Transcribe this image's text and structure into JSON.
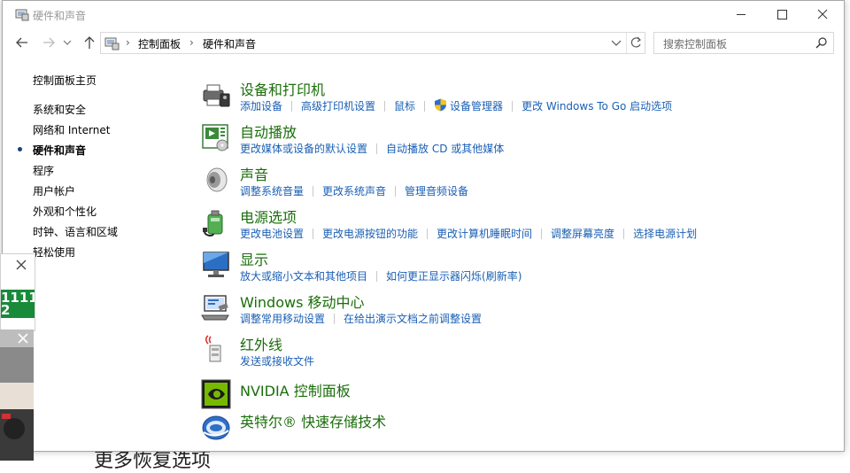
{
  "background": {
    "partial_text": "更多恢复选项"
  },
  "window": {
    "title": "硬件和声音"
  },
  "address": {
    "crumbs": [
      "控制面板",
      "硬件和声音"
    ],
    "search_placeholder": "搜索控制面板"
  },
  "sidebar": {
    "items": [
      {
        "label": "控制面板主页",
        "selected": false
      },
      {
        "label": "系统和安全",
        "selected": false
      },
      {
        "label": "网络和 Internet",
        "selected": false
      },
      {
        "label": "硬件和声音",
        "selected": true
      },
      {
        "label": "程序",
        "selected": false
      },
      {
        "label": "用户帐户",
        "selected": false
      },
      {
        "label": "外观和个性化",
        "selected": false
      },
      {
        "label": "时钟、语言和区域",
        "selected": false
      },
      {
        "label": "轻松使用",
        "selected": false
      }
    ]
  },
  "categories": [
    {
      "title": "设备和打印机",
      "icon": "printer-icon",
      "links": [
        "添加设备",
        "高级打印机设置",
        "鼠标",
        "设备管理器",
        "更改 Windows To Go 启动选项"
      ]
    },
    {
      "title": "自动播放",
      "icon": "autoplay-icon",
      "links": [
        "更改媒体或设备的默认设置",
        "自动播放 CD 或其他媒体"
      ]
    },
    {
      "title": "声音",
      "icon": "speaker-icon",
      "links": [
        "调整系统音量",
        "更改系统声音",
        "管理音频设备"
      ]
    },
    {
      "title": "电源选项",
      "icon": "power-icon",
      "links": [
        "更改电池设置",
        "更改电源按钮的功能",
        "更改计算机睡眠时间",
        "调整屏幕亮度",
        "选择电源计划"
      ]
    },
    {
      "title": "显示",
      "icon": "display-icon",
      "links": [
        "放大或缩小文本和其他项目",
        "如何更正显示器闪烁(刷新率)"
      ]
    },
    {
      "title": "Windows 移动中心",
      "icon": "mobility-center-icon",
      "links": [
        "调整常用移动设置",
        "在给出演示文档之前调整设置"
      ]
    },
    {
      "title": "红外线",
      "icon": "infrared-icon",
      "links": [
        "发送或接收文件"
      ]
    },
    {
      "title": "NVIDIA 控制面板",
      "icon": "nvidia-icon",
      "links": []
    },
    {
      "title": "英特尔® 快速存储技术",
      "icon": "intel-rst-icon",
      "links": []
    }
  ],
  "popup": {
    "green_text": [
      "1111",
      "2"
    ]
  },
  "colors": {
    "category_title": "#1a6e0a",
    "link": "#1a5fb4",
    "popup_green": "#188a3a"
  }
}
